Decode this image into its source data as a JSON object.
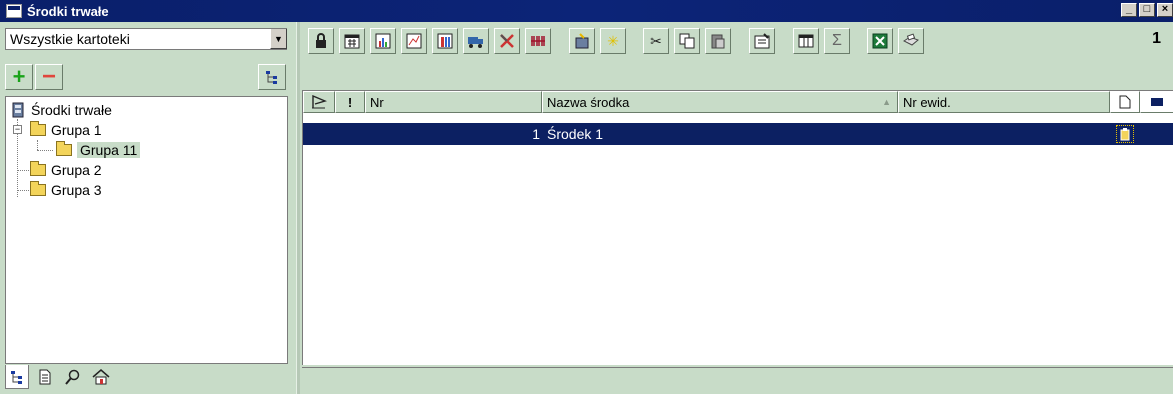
{
  "window": {
    "title": "Środki trwałe",
    "buttons": {
      "minimize": "_",
      "maximize": "□",
      "close": "×"
    }
  },
  "left": {
    "filter": {
      "value": "Wszystkie kartoteki",
      "dropdown_icon": "▼"
    },
    "add_icon": "+",
    "remove_icon": "−",
    "tree": {
      "root": "Środki trwałe",
      "items": [
        {
          "label": "Grupa 1",
          "expander": "−"
        },
        {
          "label": "Grupa 11"
        },
        {
          "label": "Grupa 2"
        },
        {
          "label": "Grupa 3"
        }
      ]
    },
    "bottom_tabs": [
      "tree-icon",
      "document-icon",
      "search-icon",
      "home-icon"
    ]
  },
  "toolbar": {
    "icons": [
      "lock-icon",
      "calendar-icon",
      "chart-icon",
      "chart-scatter-icon",
      "chart-bar-icon",
      "truck-icon",
      "tools-icon",
      "barcode-icon",
      "import-icon",
      "star-icon",
      "cut-icon",
      "copy-icon",
      "paste-icon",
      "properties-icon",
      "columns-icon",
      "sum-icon",
      "excel-icon",
      "print-icon"
    ],
    "glyphs": {
      "sum": "Σ",
      "star": "✳",
      "cut": "✂"
    },
    "counter": "1"
  },
  "grid": {
    "columns": [
      {
        "label": "",
        "icon": "flag-icon"
      },
      {
        "label": "!"
      },
      {
        "label": "Nr"
      },
      {
        "label": "Nazwa środka",
        "sort": "▲"
      },
      {
        "label": "Nr ewid."
      },
      {
        "label": "",
        "icon": "page-icon"
      },
      {
        "label": "",
        "icon": "tag-icon"
      }
    ],
    "rows": [
      {
        "nr": "1",
        "name": "Środek 1",
        "nr_ewid": "",
        "selected": true
      }
    ]
  },
  "colors": {
    "title_bg": "#0a1f6a",
    "pane_bg": "#c8dcc8",
    "selection": "#0c2062"
  }
}
